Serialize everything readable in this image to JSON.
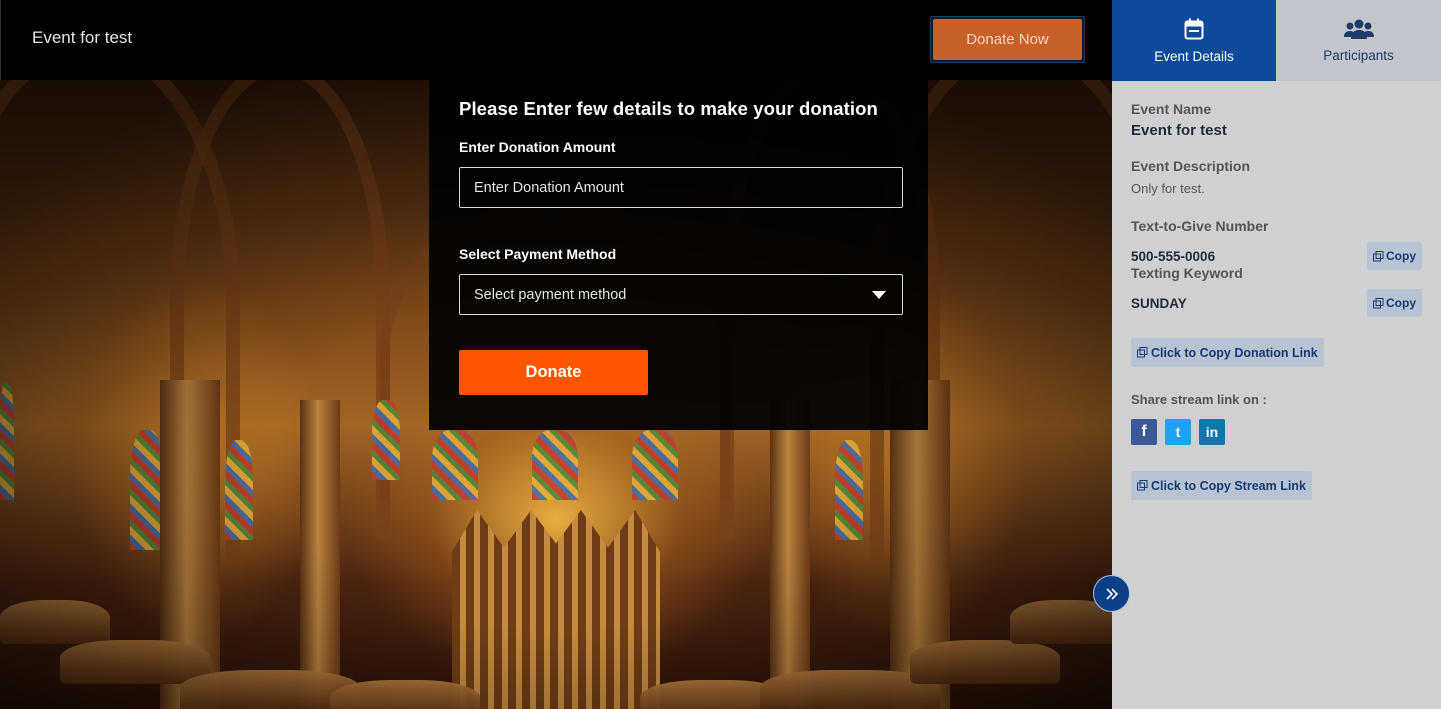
{
  "header": {
    "event_title": "Event for test",
    "donate_now_label": "Donate Now"
  },
  "form": {
    "heading": "Please Enter few details to make your donation",
    "amount_label": "Enter Donation Amount",
    "amount_placeholder": "Enter Donation Amount",
    "payment_label": "Select Payment Method",
    "payment_placeholder": "Select payment method",
    "donate_label": "Donate"
  },
  "sidebar": {
    "tabs": [
      {
        "label": "Event Details",
        "icon": "calendar-icon",
        "active": true
      },
      {
        "label": "Participants",
        "icon": "users-icon",
        "active": false
      }
    ],
    "event_name_label": "Event Name",
    "event_name_value": "Event for test",
    "event_description_label": "Event Description",
    "event_description_value": "Only for test.",
    "text_to_give_label": "Text-to-Give Number",
    "text_to_give_value": "500-555-0006",
    "keyword_label": "Texting Keyword",
    "keyword_value": "SUNDAY",
    "copy_label": "Copy",
    "copy_donation_link_label": "Click to Copy Donation Link",
    "share_label": "Share stream link on :",
    "socials": [
      {
        "name": "facebook",
        "glyph": "f",
        "color": "#3b5998"
      },
      {
        "name": "twitter",
        "glyph": "t",
        "color": "#1da1f2"
      },
      {
        "name": "linkedin",
        "glyph": "in",
        "color": "#0e76a8"
      }
    ],
    "copy_stream_link_label": "Click to Copy Stream Link"
  },
  "colors": {
    "accent_orange": "#ff5500",
    "brand_blue": "#0d4a9a",
    "sidebar_bg": "#d0d0d0"
  }
}
